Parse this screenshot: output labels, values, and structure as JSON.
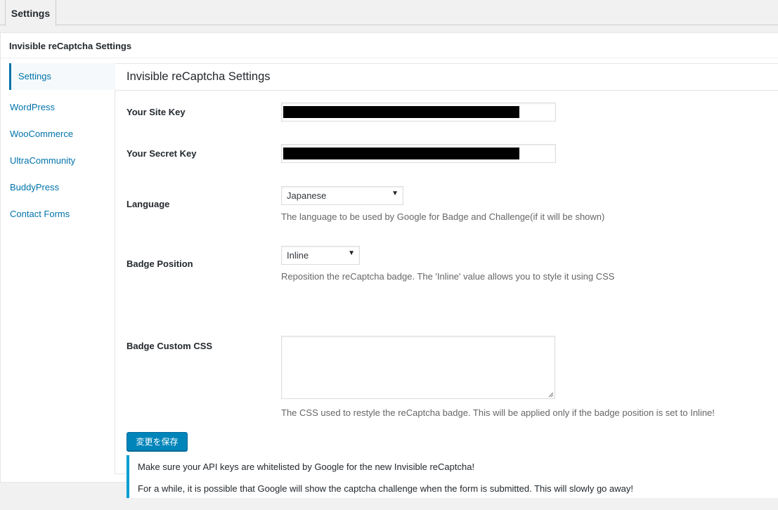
{
  "tabs": {
    "active_label": "Settings"
  },
  "panel": {
    "title": "Invisible reCaptcha Settings"
  },
  "sidebar": {
    "items": [
      {
        "label": "Settings",
        "active": true
      },
      {
        "label": "WordPress"
      },
      {
        "label": "WooCommerce"
      },
      {
        "label": "UltraCommunity"
      },
      {
        "label": "BuddyPress"
      },
      {
        "label": "Contact Forms"
      }
    ]
  },
  "content": {
    "title": "Invisible reCaptcha Settings",
    "site_key": {
      "label": "Your Site Key",
      "value": ""
    },
    "secret_key": {
      "label": "Your Secret Key",
      "value": ""
    },
    "language": {
      "label": "Language",
      "selected": "Japanese",
      "description": "The language to be used by Google for Badge and Challenge(if it will be shown)"
    },
    "badge_position": {
      "label": "Badge Position",
      "selected": "Inline",
      "description": "Reposition the reCaptcha badge. The 'Inline' value allows you to style it using CSS"
    },
    "badge_css": {
      "label": "Badge Custom CSS",
      "value": "",
      "description": "The CSS used to restyle the reCaptcha badge. This will be applied only if the badge position is set to Inline!"
    },
    "save_label": "変更を保存"
  },
  "notice": {
    "line1": "Make sure your API keys are whitelisted by Google for the new Invisible reCaptcha!",
    "line2": "For a while, it is possible that Google will show the captcha challenge when the form is submitted. This will slowly go away!"
  },
  "colors": {
    "accent": "#0073aa",
    "button": "#0085ba",
    "notice_border": "#00a0d2",
    "mask": "#000000"
  }
}
